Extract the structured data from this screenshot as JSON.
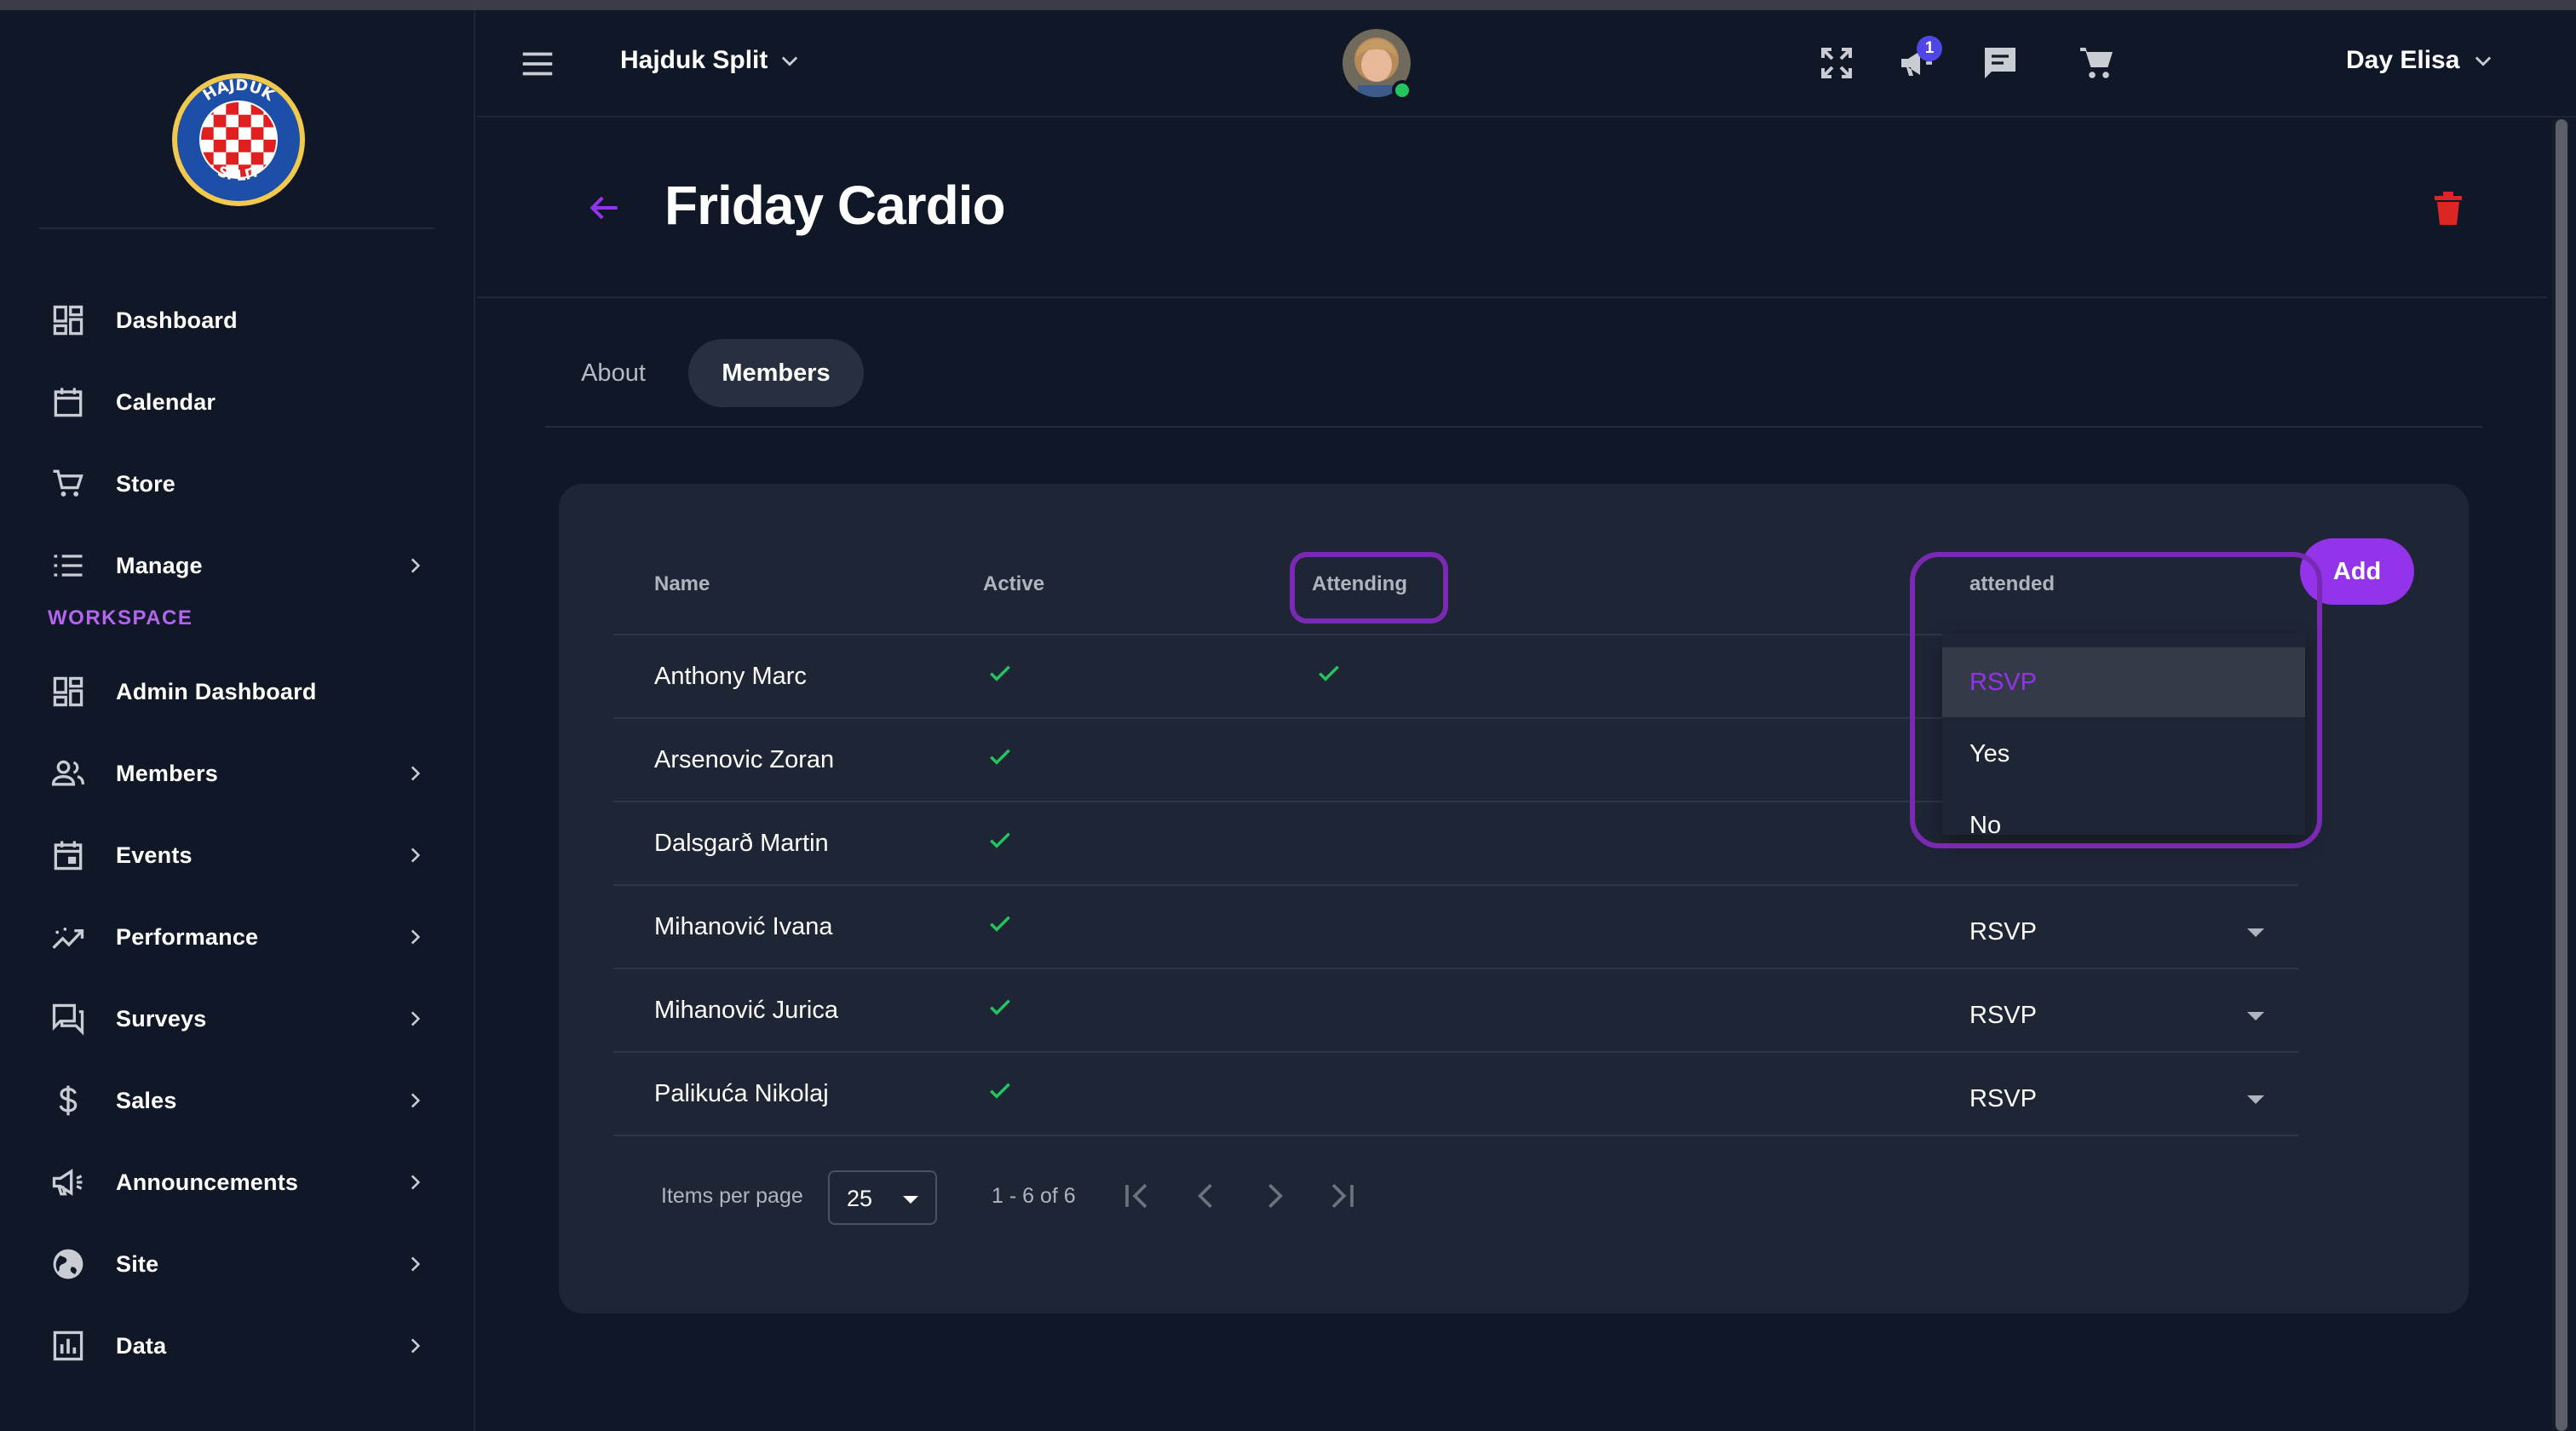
{
  "app": {
    "org_name": "Hajduk Split",
    "logo_text": "HAJDUK SPLIT",
    "user_name": "Day Elisa",
    "notification_count": "1"
  },
  "sidebar": {
    "items": [
      {
        "label": "Dashboard",
        "icon": "dashboard-icon"
      },
      {
        "label": "Calendar",
        "icon": "calendar-icon"
      },
      {
        "label": "Store",
        "icon": "cart-icon"
      },
      {
        "label": "Manage",
        "icon": "list-icon"
      }
    ],
    "section_label": "WORKSPACE",
    "workspace_items": [
      {
        "label": "Admin Dashboard",
        "icon": "dashboard-icon"
      },
      {
        "label": "Members",
        "icon": "people-icon"
      },
      {
        "label": "Events",
        "icon": "event-icon"
      },
      {
        "label": "Performance",
        "icon": "trend-icon"
      },
      {
        "label": "Surveys",
        "icon": "forum-icon"
      },
      {
        "label": "Sales",
        "icon": "dollar-icon"
      },
      {
        "label": "Announcements",
        "icon": "megaphone-icon"
      },
      {
        "label": "Site",
        "icon": "globe-icon"
      },
      {
        "label": "Data",
        "icon": "chart-icon"
      }
    ]
  },
  "page": {
    "title": "Friday Cardio",
    "tabs": [
      {
        "label": "About",
        "active": false
      },
      {
        "label": "Members",
        "active": true
      }
    ],
    "add_label": "Add"
  },
  "table": {
    "columns": [
      "Name",
      "Active",
      "Attending",
      "attended"
    ],
    "rows": [
      {
        "name": "Anthony Marc",
        "active": true,
        "attending": true,
        "attended": "RSVP"
      },
      {
        "name": "Arsenovic Zoran",
        "active": true,
        "attending": false,
        "attended": "RSVP"
      },
      {
        "name": "Dalsgarð Martin",
        "active": true,
        "attending": false,
        "attended": "RSVP"
      },
      {
        "name": "Mihanović Ivana",
        "active": true,
        "attending": false,
        "attended": "RSVP"
      },
      {
        "name": "Mihanović Jurica",
        "active": true,
        "attending": false,
        "attended": "RSVP"
      },
      {
        "name": "Palikuća Nikolaj",
        "active": true,
        "attending": false,
        "attended": "RSVP"
      }
    ],
    "dropdown_options": [
      "RSVP",
      "Yes",
      "No"
    ],
    "dropdown_selected": "RSVP"
  },
  "pagination": {
    "items_per_page_label": "Items per page",
    "page_size": "25",
    "range": "1 - 6 of 6"
  },
  "colors": {
    "background": "#101727",
    "card": "#1e2535",
    "accent": "#9333ea",
    "check": "#22c55e",
    "delete": "#dc2626",
    "highlight": "#7a2ab2"
  }
}
